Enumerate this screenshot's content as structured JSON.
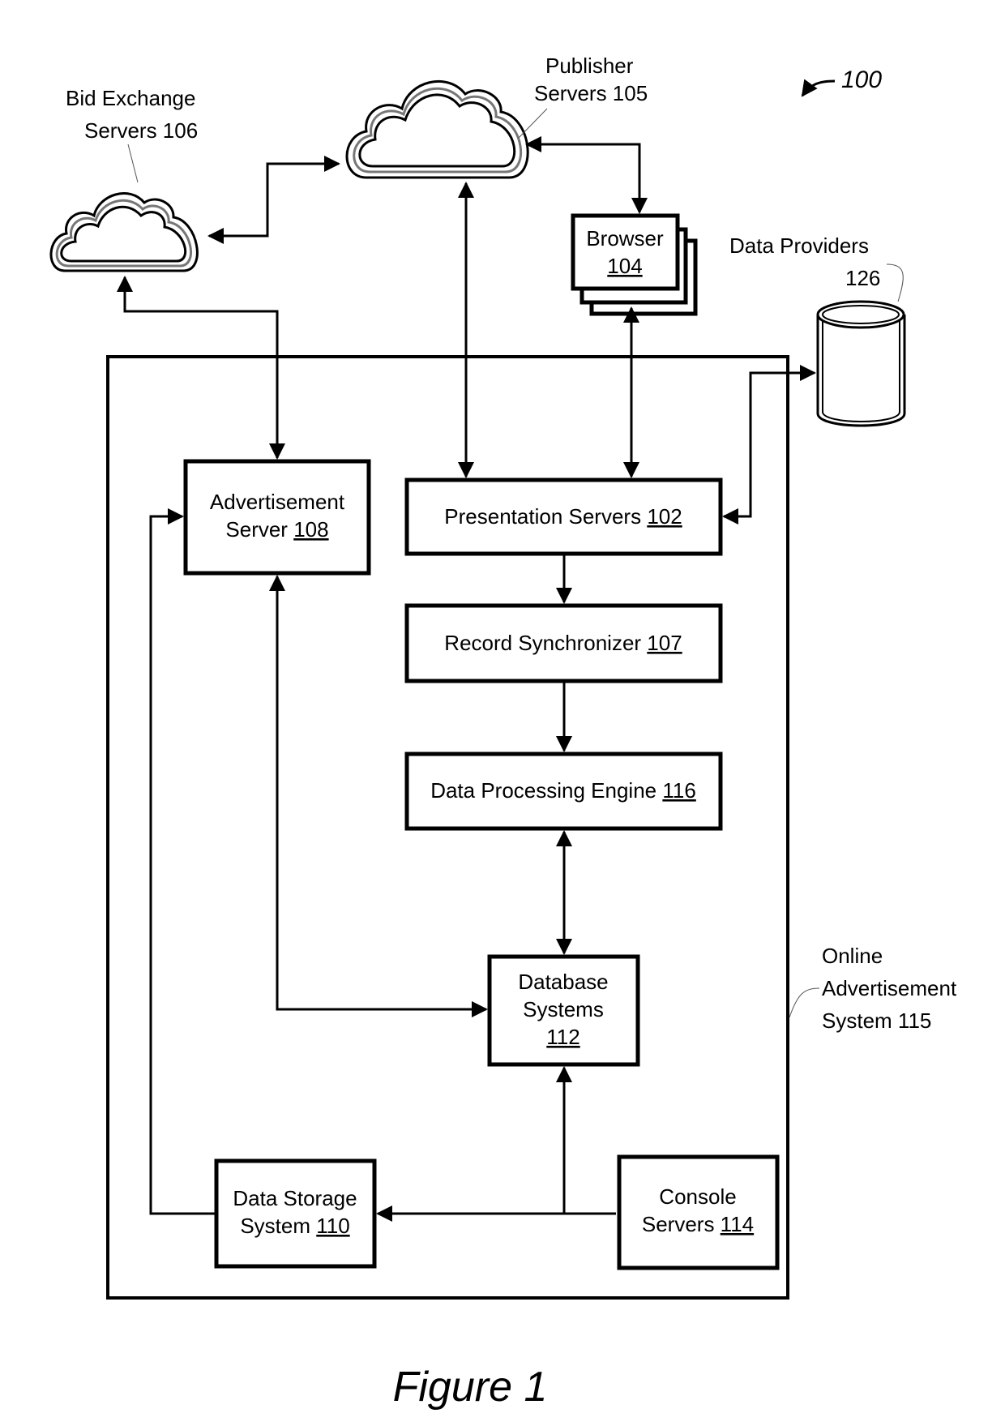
{
  "figure": {
    "reference": "100",
    "caption": "Figure 1"
  },
  "clouds": {
    "bid_exchange": {
      "line1": "Bid Exchange",
      "line2": "Servers 106"
    },
    "publisher": {
      "line1": "Publisher",
      "line2": "Servers 105"
    }
  },
  "browser": {
    "line1": "Browser",
    "num": "104"
  },
  "data_providers": {
    "line1": "Data Providers",
    "num": "126"
  },
  "system": {
    "line1": "Online",
    "line2": "Advertisement",
    "line3": "System 115"
  },
  "boxes": {
    "ad_server": {
      "line1": "Advertisement",
      "line2": "Server ",
      "num": "108"
    },
    "presentation": {
      "text": "Presentation Servers ",
      "num": "102"
    },
    "record_sync": {
      "text": "Record Synchronizer ",
      "num": "107"
    },
    "dpe": {
      "text": "Data Processing Engine ",
      "num": "116"
    },
    "database": {
      "line1": "Database",
      "line2": "Systems",
      "num": "112"
    },
    "data_storage": {
      "line1": "Data Storage",
      "line2": "System ",
      "num": "110"
    },
    "console": {
      "line1": "Console",
      "line2": "Servers ",
      "num": "114"
    }
  }
}
